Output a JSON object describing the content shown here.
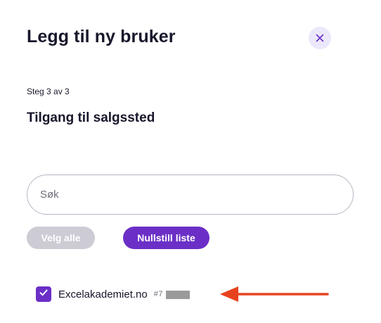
{
  "modal": {
    "title": "Legg til ny bruker",
    "close_icon": "close-icon",
    "step_text": "Steg 3 av 3",
    "section_title": "Tilgang til salgssted"
  },
  "search": {
    "placeholder": "Søk",
    "value": ""
  },
  "actions": {
    "select_all_label": "Velg alle",
    "reset_label": "Nullstill liste"
  },
  "list": {
    "items": [
      {
        "name": "Excelakademiet.no",
        "id": "#7        9",
        "checked": true,
        "check_icon": "checkmark-icon"
      }
    ]
  },
  "annotation": {
    "arrow_icon": "arrow-left-icon",
    "arrow_color": "#e8431f"
  },
  "colors": {
    "accent": "#6b2fc7",
    "close_bg": "#ece8fb",
    "disabled_button": "#cdcbd4",
    "text": "#17172b"
  }
}
